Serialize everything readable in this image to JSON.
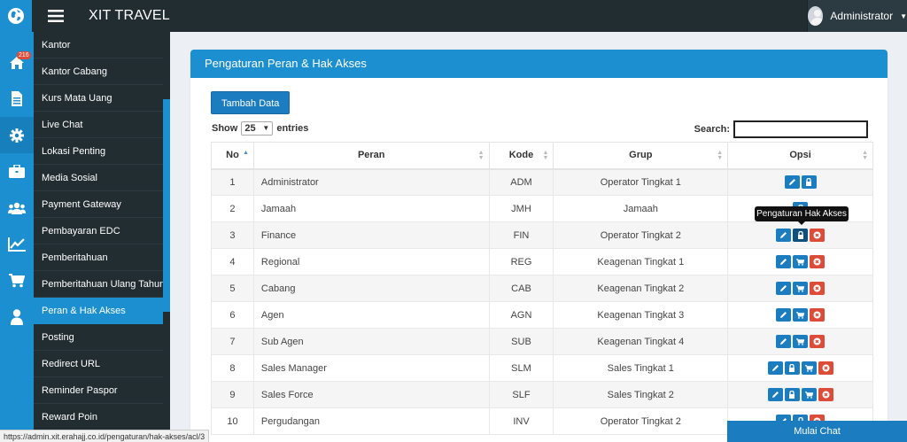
{
  "header": {
    "brand": "XIT TRAVEL",
    "user_name": "Administrator"
  },
  "icon_bar": {
    "items": [
      {
        "icon": "home-icon",
        "badge": "216"
      },
      {
        "icon": "document-icon"
      },
      {
        "icon": "gear-icon"
      },
      {
        "icon": "briefcase-icon"
      },
      {
        "icon": "users-icon"
      },
      {
        "icon": "chart-icon"
      },
      {
        "icon": "cart-icon"
      },
      {
        "icon": "user-icon"
      }
    ]
  },
  "menu": {
    "items": [
      {
        "label": "Kantor"
      },
      {
        "label": "Kantor Cabang"
      },
      {
        "label": "Kurs Mata Uang"
      },
      {
        "label": "Live Chat"
      },
      {
        "label": "Lokasi Penting"
      },
      {
        "label": "Media Sosial"
      },
      {
        "label": "Payment Gateway"
      },
      {
        "label": "Pembayaran EDC"
      },
      {
        "label": "Pemberitahuan"
      },
      {
        "label": "Pemberitahuan Ulang Tahun"
      },
      {
        "label": "Peran & Hak Akses",
        "active": true
      },
      {
        "label": "Posting"
      },
      {
        "label": "Redirect URL"
      },
      {
        "label": "Reminder Paspor"
      },
      {
        "label": "Reward Poin"
      }
    ]
  },
  "panel": {
    "title": "Pengaturan Peran & Hak Akses",
    "add_button": "Tambah Data",
    "show_label": "Show",
    "show_value": "25",
    "entries_label": "entries",
    "search_label": "Search:",
    "search_value": ""
  },
  "table": {
    "columns": [
      "No",
      "Peran",
      "Kode",
      "Grup",
      "Opsi"
    ],
    "rows": [
      {
        "no": "1",
        "peran": "Administrator",
        "kode": "ADM",
        "grup": "Operator Tingkat 1",
        "opsi": [
          "edit",
          "lock"
        ]
      },
      {
        "no": "2",
        "peran": "Jamaah",
        "kode": "JMH",
        "grup": "Jamaah",
        "opsi": [
          "lock"
        ]
      },
      {
        "no": "3",
        "peran": "Finance",
        "kode": "FIN",
        "grup": "Operator Tingkat 2",
        "opsi": [
          "edit",
          "lock",
          "delete"
        ]
      },
      {
        "no": "4",
        "peran": "Regional",
        "kode": "REG",
        "grup": "Keagenan Tingkat 1",
        "opsi": [
          "edit",
          "cart",
          "delete"
        ]
      },
      {
        "no": "5",
        "peran": "Cabang",
        "kode": "CAB",
        "grup": "Keagenan Tingkat 2",
        "opsi": [
          "edit",
          "cart",
          "delete"
        ]
      },
      {
        "no": "6",
        "peran": "Agen",
        "kode": "AGN",
        "grup": "Keagenan Tingkat 3",
        "opsi": [
          "edit",
          "cart",
          "delete"
        ]
      },
      {
        "no": "7",
        "peran": "Sub Agen",
        "kode": "SUB",
        "grup": "Keagenan Tingkat 4",
        "opsi": [
          "edit",
          "cart",
          "delete"
        ]
      },
      {
        "no": "8",
        "peran": "Sales Manager",
        "kode": "SLM",
        "grup": "Sales Tingkat 1",
        "opsi": [
          "edit",
          "lock",
          "cart",
          "delete"
        ]
      },
      {
        "no": "9",
        "peran": "Sales Force",
        "kode": "SLF",
        "grup": "Sales Tingkat 2",
        "opsi": [
          "edit",
          "lock",
          "cart",
          "delete"
        ]
      },
      {
        "no": "10",
        "peran": "Pergudangan",
        "kode": "INV",
        "grup": "Operator Tingkat 2",
        "opsi": [
          "edit",
          "lock",
          "delete"
        ]
      }
    ]
  },
  "tooltip": "Pengaturan Hak Akses",
  "status_url": "https://admin.xit.erahajj.co.id/pengaturan/hak-akses/acl/3",
  "chat_label": "Mulai Chat",
  "colors": {
    "primary": "#1c8fd1",
    "sidebar_dark": "#222d32",
    "danger": "#dd4b39"
  }
}
